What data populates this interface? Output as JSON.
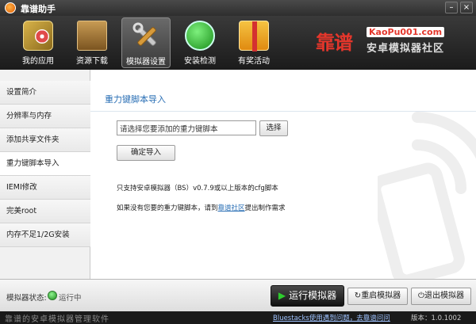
{
  "window": {
    "title": "靠谱助手",
    "minimize_icon": "minimize-icon",
    "close_icon": "close-icon"
  },
  "toolbar": {
    "items": [
      {
        "label": "我的应用",
        "icon": "apps-book-icon"
      },
      {
        "label": "资源下载",
        "icon": "download-box-icon"
      },
      {
        "label": "模拟器设置",
        "icon": "tools-icon",
        "active": true
      },
      {
        "label": "安装检测",
        "icon": "check-monitor-icon"
      },
      {
        "label": "有奖活动",
        "icon": "gift-icon"
      }
    ]
  },
  "brand": {
    "name": "靠谱",
    "url": "KaoPu001.com",
    "tagline": "安卓模拟器社区"
  },
  "sidebar": {
    "items": [
      {
        "label": "设置简介"
      },
      {
        "label": "分辨率与内存"
      },
      {
        "label": "添加共享文件夹"
      },
      {
        "label": "重力键脚本导入",
        "active": true
      },
      {
        "label": "IEMI修改"
      },
      {
        "label": "完美root"
      },
      {
        "label": "内存不足1/2G安装"
      }
    ]
  },
  "main": {
    "title": "重力键脚本导入",
    "path_input_value": "请选择您要添加的重力键脚本",
    "browse_label": "选择",
    "import_label": "确定导入",
    "info_line1": "只支持安卓模拟器（BS）v0.7.9或以上版本的cfg脚本",
    "info_line2_prefix": "如果没有您要的重力键脚本，请到",
    "info_line2_link": "靠谱社区",
    "info_line2_suffix": "提出制作需求"
  },
  "statusbar": {
    "label": "模拟器状态:",
    "value": "运行中",
    "run_label": "运行模拟器",
    "restart_label": "重启模拟器",
    "exit_label": "退出模拟器"
  },
  "footer": {
    "left": "靠谱的安卓模拟器管理软件",
    "help_link": "Bluestacks使用遇到问题，去靠谱问问",
    "version": "版本：1.0.1002"
  }
}
